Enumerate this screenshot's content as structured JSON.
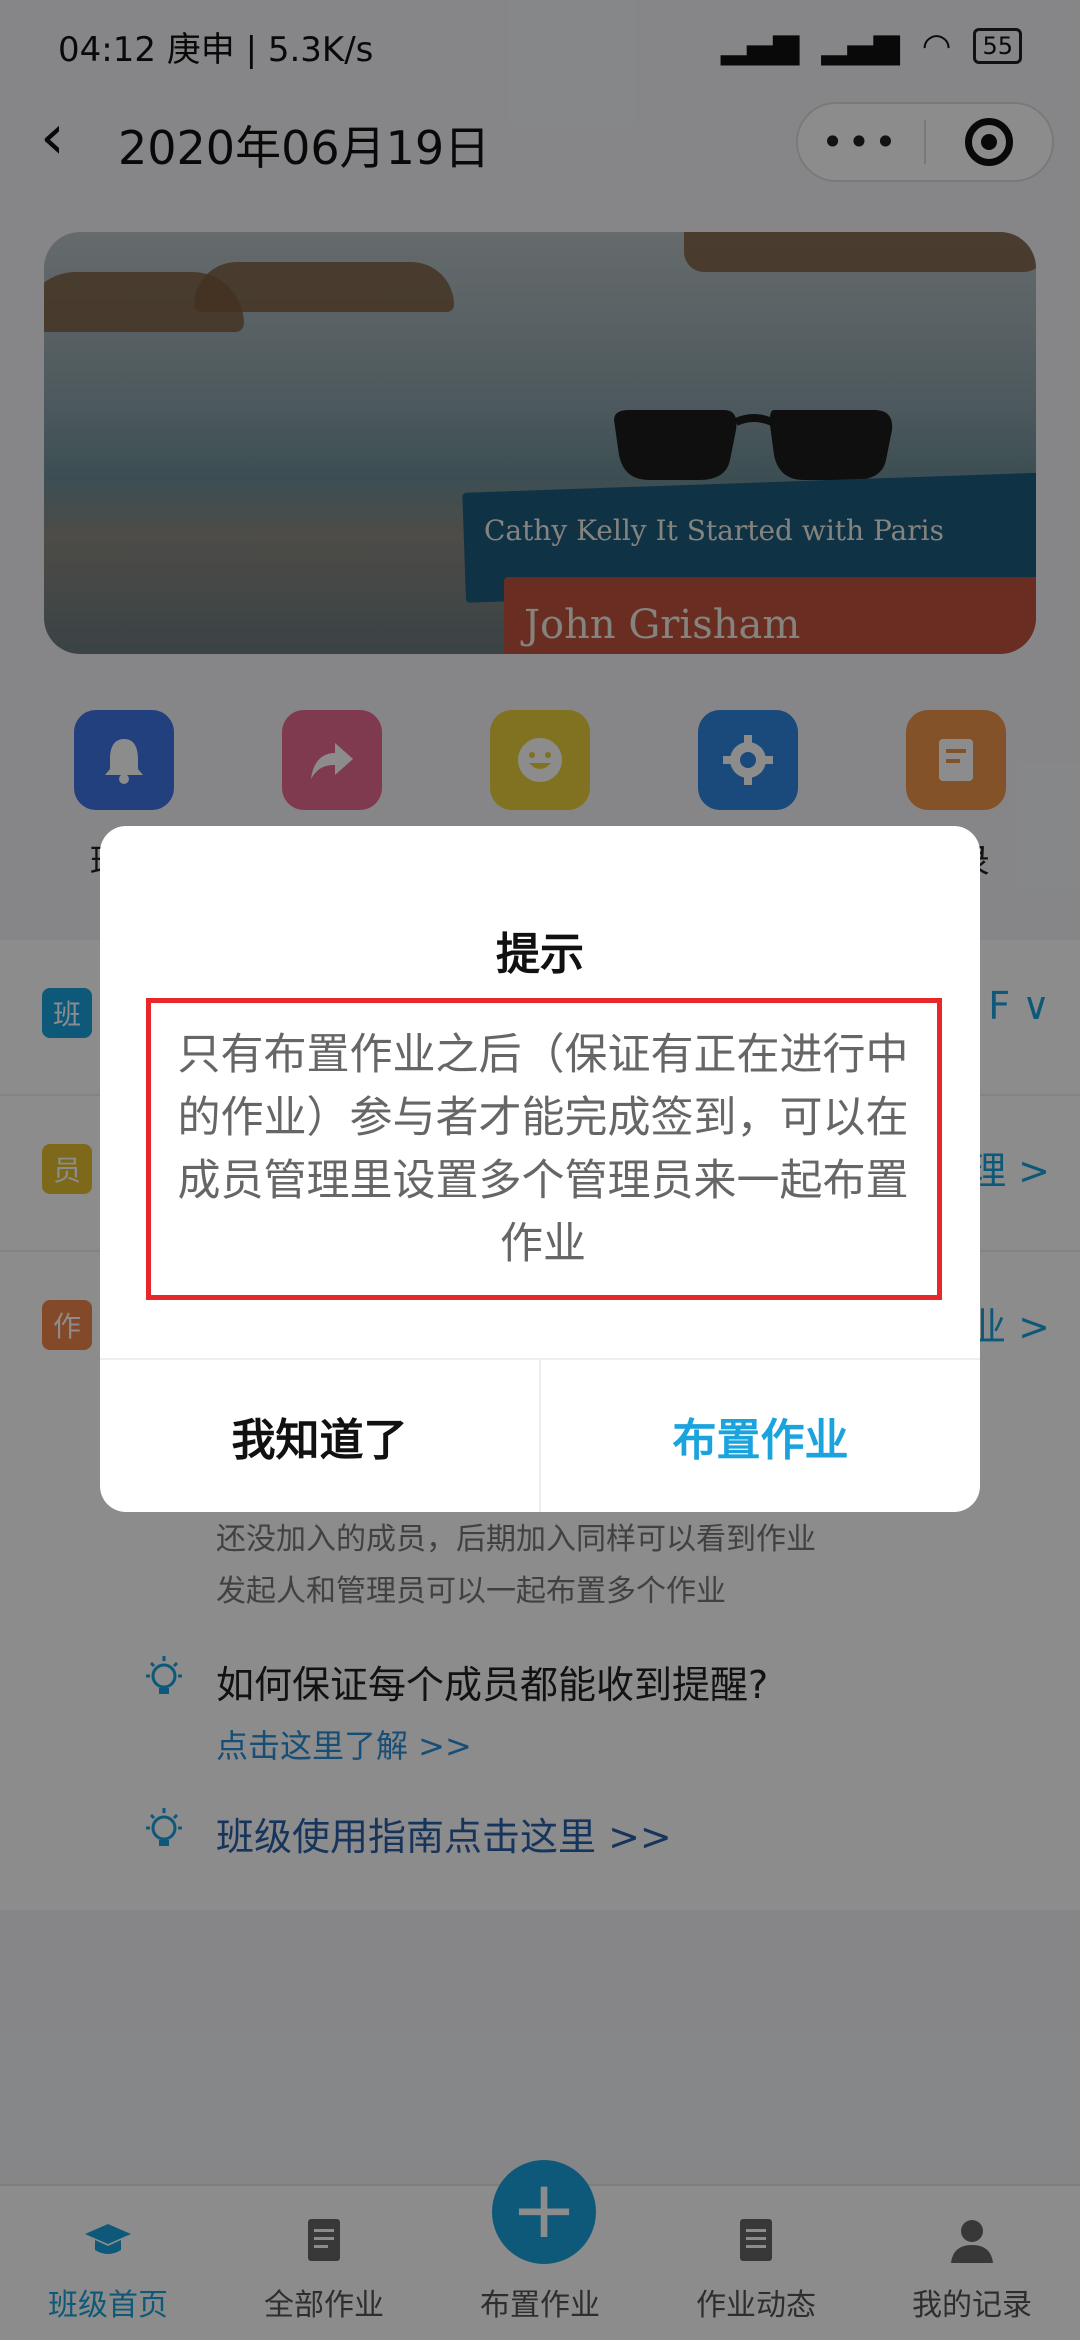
{
  "status": {
    "time": "04:12 庚申 | 5.3K/s",
    "battery": "55"
  },
  "nav": {
    "back_icon": "chevron-left-icon",
    "title": "2020年06月19日",
    "more": "•••"
  },
  "banner": {
    "book1": "Cathy Kelly  It Started with Paris",
    "book2": "John Grisham"
  },
  "shortcuts": [
    {
      "label": "班级",
      "icon": "bell-icon",
      "color": "#3f73e6"
    },
    {
      "label": "",
      "icon": "share-icon",
      "color": "#e86a93"
    },
    {
      "label": "",
      "icon": "smile-icon",
      "color": "#e9cf3b"
    },
    {
      "label": "",
      "icon": "gear-icon",
      "color": "#2e88e0"
    },
    {
      "label": "记录",
      "icon": "note-icon",
      "color": "#f0954a"
    }
  ],
  "rows": [
    {
      "tag": "班",
      "color": "#1aa3dd",
      "right": "F ∨"
    },
    {
      "tag": "员",
      "color": "#e4c02f",
      "right": "理 >"
    },
    {
      "tag": "作",
      "color": "#f0854a",
      "right": "业 >"
    }
  ],
  "info": {
    "line1": "还没加入的成员，后期加入同样可以看到作业",
    "line2": "发起人和管理员可以一起布置多个作业",
    "tip1_title": "如何保证每个成员都能收到提醒?",
    "tip1_link": "点击这里了解 >>",
    "tip2_title": "班级使用指南点击这里 >>"
  },
  "tabs": [
    {
      "label": "班级首页",
      "icon": "graduation-cap-icon",
      "active": true
    },
    {
      "label": "全部作业",
      "icon": "document-icon",
      "active": false
    },
    {
      "label": "布置作业",
      "icon": "plus-icon",
      "active": false
    },
    {
      "label": "作业动态",
      "icon": "list-icon",
      "active": false
    },
    {
      "label": "我的记录",
      "icon": "user-icon",
      "active": false
    }
  ],
  "fab": "+",
  "dialog": {
    "title": "提示",
    "message": "只有布置作业之后（保证有正在进行中的作业）参与者才能完成签到，可以在成员管理里设置多个管理员来一起布置作业",
    "cancel_label": "我知道了",
    "ok_label": "布置作业",
    "highlight_color": "#e8272b"
  }
}
